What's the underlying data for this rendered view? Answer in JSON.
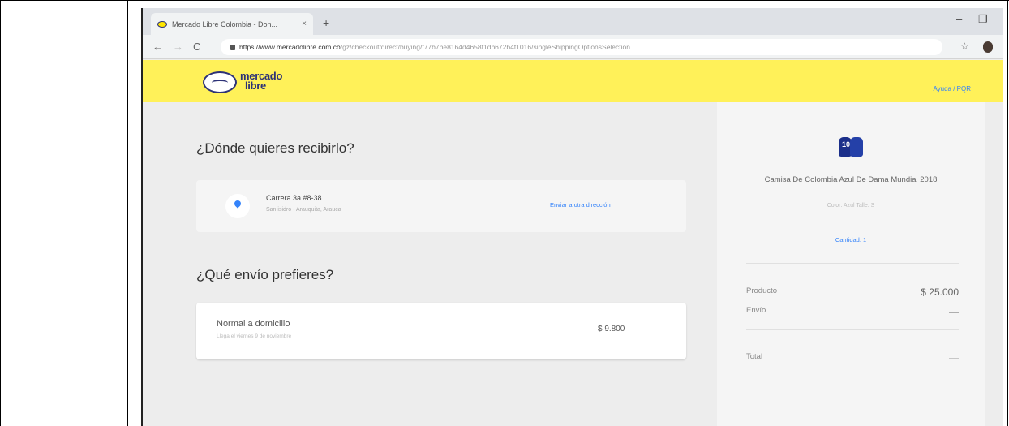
{
  "browser": {
    "tab_title": "Mercado Libre Colombia - Don...",
    "tab_close": "×",
    "new_tab": "+",
    "url_host": "https://www.mercadolibre.com.co",
    "url_path": "/gz/checkout/direct/buying/f77b7be8164d4658f1db672b4f1016/singleShippingOptionsSelection",
    "back": "←",
    "forward": "→",
    "reload": "C",
    "star": "☆",
    "minimize": "–",
    "restore": "❐"
  },
  "site": {
    "logo_line1": "mercado",
    "logo_line2": "libre",
    "help_link": "Ayuda / PQR"
  },
  "checkout": {
    "address_heading": "¿Dónde quieres recibirlo?",
    "address_line1": "Carrera 3a #8-38",
    "address_line2": "San isidro - Arauquita, Arauca",
    "address_change": "Enviar a otra dirección",
    "shipping_heading": "¿Qué envío prefieres?",
    "shipping_option": "Normal a domicilio",
    "shipping_eta": "Llega el viernes 9 de noviembre",
    "shipping_price": "$ 9.800"
  },
  "summary": {
    "product_name": "Camisa De Colombia Azul De Dama Mundial 2018",
    "variant": "Color: Azul Talle: S",
    "quantity": "Cantidad: 1",
    "product_label": "Producto",
    "product_value": "$ 25.000",
    "shipping_label": "Envío",
    "shipping_value": "—",
    "total_label": "Total",
    "total_value": "—"
  },
  "colors": {
    "brand_yellow": "#fff159",
    "brand_blue": "#2d3277",
    "link_blue": "#3483fa"
  }
}
